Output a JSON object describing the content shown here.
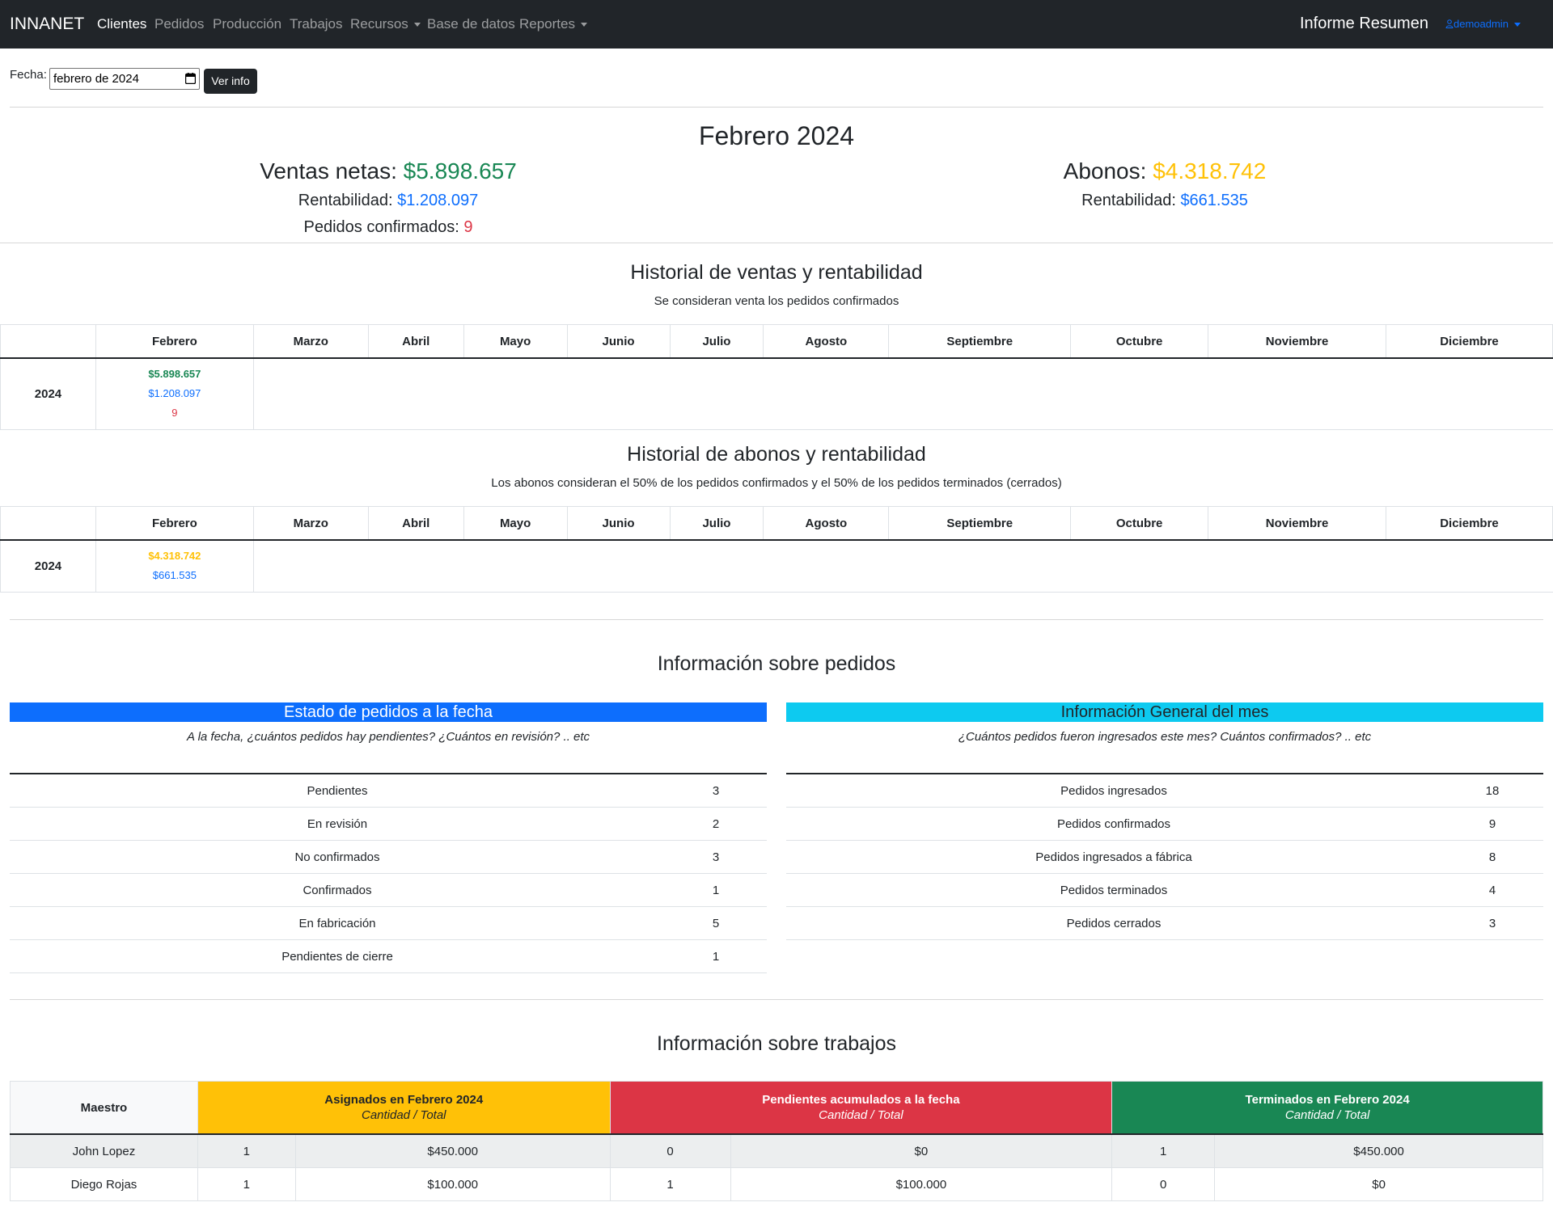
{
  "navbar": {
    "brand": "INNANET",
    "links": [
      {
        "label": "Clientes"
      },
      {
        "label": "Pedidos"
      },
      {
        "label": "Producción"
      },
      {
        "label": "Trabajos"
      },
      {
        "label": "Recursos"
      },
      {
        "label": "Base de datos"
      },
      {
        "label": "Reportes"
      }
    ],
    "page_title": "Informe Resumen",
    "user": "demoadmin"
  },
  "filter": {
    "label": "Fecha:",
    "value": "febrero de 2024",
    "button": "Ver info"
  },
  "summary": {
    "title": "Febrero 2024",
    "ventas_label": "Ventas netas:",
    "ventas_value": "$5.898.657",
    "rent_label": "Rentabilidad:",
    "rent_value": "$1.208.097",
    "pedidos_label": "Pedidos confirmados:",
    "pedidos_value": "9",
    "abonos_label": "Abonos:",
    "abonos_value": "$4.318.742",
    "abonos_rent_label": "Rentabilidad:",
    "abonos_rent_value": "$661.535"
  },
  "months": [
    "Febrero",
    "Marzo",
    "Abril",
    "Mayo",
    "Junio",
    "Julio",
    "Agosto",
    "Septiembre",
    "Octubre",
    "Noviembre",
    "Diciembre"
  ],
  "ventas_hist": {
    "title": "Historial de ventas y rentabilidad",
    "subtitle": "Se consideran venta los pedidos confirmados",
    "year": "2024",
    "values": [
      "$5.898.657",
      "$1.208.097",
      "9"
    ]
  },
  "abonos_hist": {
    "title": "Historial de abonos y rentabilidad",
    "subtitle": "Los abonos consideran el 50% de los pedidos confirmados y el 50% de los pedidos terminados (cerrados)",
    "year": "2024",
    "values": [
      "$4.318.742",
      "$661.535"
    ]
  },
  "pedidos": {
    "title": "Información sobre pedidos",
    "estado": {
      "header": "Estado de pedidos a la fecha",
      "subtitle": "A la fecha, ¿cuántos pedidos hay pendientes? ¿Cuántos en revisión? .. etc",
      "rows": [
        {
          "label": "Pendientes",
          "value": "3"
        },
        {
          "label": "En revisión",
          "value": "2"
        },
        {
          "label": "No confirmados",
          "value": "3"
        },
        {
          "label": "Confirmados",
          "value": "1"
        },
        {
          "label": "En fabricación",
          "value": "5"
        },
        {
          "label": "Pendientes de cierre",
          "value": "1"
        }
      ]
    },
    "general": {
      "header": "Información General del mes",
      "subtitle": "¿Cuántos pedidos fueron ingresados este mes? Cuántos confirmados? .. etc",
      "rows": [
        {
          "label": "Pedidos ingresados",
          "value": "18"
        },
        {
          "label": "Pedidos confirmados",
          "value": "9"
        },
        {
          "label": "Pedidos ingresados a fábrica",
          "value": "8"
        },
        {
          "label": "Pedidos terminados",
          "value": "4"
        },
        {
          "label": "Pedidos cerrados",
          "value": "3"
        }
      ]
    }
  },
  "trabajos": {
    "title": "Información sobre trabajos",
    "col_maestro": "Maestro",
    "col_asignados": "Asignados en Febrero 2024",
    "col_pendientes": "Pendientes acumulados a la fecha",
    "col_terminados": "Terminados en Febrero 2024",
    "sub": "Cantidad / Total",
    "rows": [
      {
        "maestro": "John Lopez",
        "a_cant": "1",
        "a_total": "$450.000",
        "p_cant": "0",
        "p_total": "$0",
        "t_cant": "1",
        "t_total": "$450.000"
      },
      {
        "maestro": "Diego Rojas",
        "a_cant": "1",
        "a_total": "$100.000",
        "p_cant": "1",
        "p_total": "$100.000",
        "t_cant": "0",
        "t_total": "$0"
      }
    ]
  },
  "colors": {
    "navbar": "#212529",
    "primary": "#0d6efd",
    "info": "#0dcaf0",
    "success": "#198754",
    "danger": "#dc3545",
    "warning": "#ffc107"
  }
}
